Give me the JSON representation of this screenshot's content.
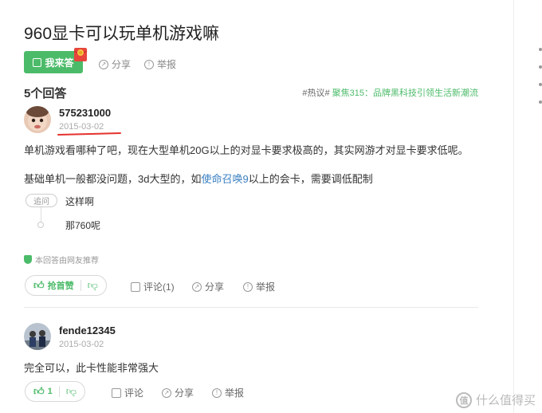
{
  "question": {
    "title": "960显卡可以玩单机游戏嘛",
    "answer_button": "我来答",
    "share": "分享",
    "report": "举报"
  },
  "answers_header": {
    "count_label": "5个回答",
    "hot_topic_prefix": "#热议#",
    "hot_topic_text": "聚焦315：品牌黑科技引领生活新潮流"
  },
  "answers": [
    {
      "username": "575231000",
      "date": "2015-03-02",
      "paragraphs": [
        "单机游戏看哪种了吧，现在大型单机20G以上的对显卡要求极高的，其实网游才对显卡要求低呢。"
      ],
      "para2_before": "基础单机一般都没问题，3d大型的，如",
      "para2_link": "使命召唤9",
      "para2_after": "以上的会卡，需要调低配制",
      "followup_tag": "追问",
      "followups": [
        "这样啊",
        "那760呢"
      ],
      "recommended": "本回答由网友推荐",
      "vote_label": "抢首赞",
      "comment": "评论(1)",
      "share": "分享",
      "report": "举报"
    },
    {
      "username": "fende12345",
      "date": "2015-03-02",
      "paragraphs": [
        "完全可以，此卡性能非常强大"
      ],
      "vote_label": "1",
      "comment": "评论",
      "share": "分享",
      "report": "举报"
    }
  ],
  "watermark": "什么值得买",
  "icons": {
    "edit": "edit-icon",
    "share": "share-icon",
    "report": "report-icon",
    "thumb_up": "thumb-up-icon",
    "thumb_down": "thumb-down-icon",
    "comment": "comment-icon",
    "shield": "shield-icon"
  },
  "colors": {
    "accent": "#4cbb69",
    "link": "#3a7fc1",
    "highlight": "#e5322d"
  }
}
